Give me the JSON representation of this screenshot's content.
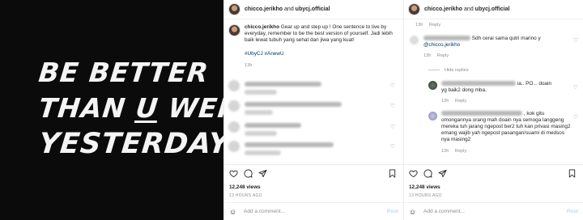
{
  "poster": {
    "line1": "Be Better",
    "line2_before": "than ",
    "line2_mark": "u",
    "line2_after": " were",
    "line3": "Yesterday"
  },
  "post": {
    "author": "chicco.jerikho",
    "joiner": "and",
    "collaborator": "ubycj.official",
    "caption_user": "chicco.jerikho",
    "caption_text": "Gear up and step up ! One sentence to live by everyday, remember to be the best version of yourself. Jadi lebih baik lewat tubuh yang sehat dan jiwa yang kuat!",
    "hashtags": "#UbyCJ #AnewU",
    "caption_age": "13h",
    "views": "12,248 views",
    "posted_ago": "13 HOURS AGO",
    "add_comment_placeholder": "Add a comment...",
    "post_label": "Post"
  },
  "thread": {
    "top_time": "13h",
    "reply_label": "Reply",
    "c1_text": "Sdh cerai sama qutri marino y",
    "c1_mention": "@chicco.jerikho",
    "c1_time": "13h",
    "hide_replies": "Hide replies",
    "r1_text_a": "ia.. PO... doain",
    "r1_text_b": "yg baik2 dong mba.",
    "r1_time": "13h",
    "r2_text_a": ", kok gitu",
    "r2_text_b": "omongannya orang mah doain nya semoga langgeng mereka tuh jarang ngepost ber2 tuh kan privasi masing2 emang wajib yah ngepost pasangan/suami di medsos nya masing2",
    "r2_time": "13h"
  },
  "icons": [
    "heart-icon",
    "comment-icon",
    "share-icon",
    "bookmark-icon",
    "emoji-icon"
  ],
  "colors": {
    "hashtag": "#00376b",
    "muted": "#8e8e8e",
    "post_button": "#b3dbff",
    "poster_bg": "#0b0b0b"
  }
}
